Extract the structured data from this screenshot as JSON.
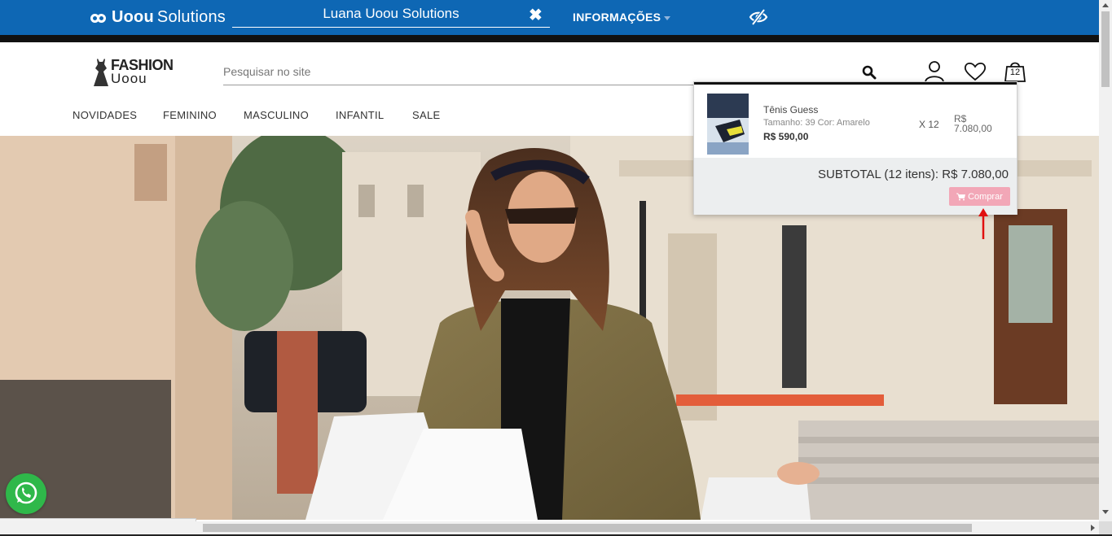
{
  "adminbar": {
    "brand_bold": "Uoou",
    "brand_light": "Solutions",
    "store_name": "Luana Uoou Solutions",
    "close_icon": "close-icon",
    "info_label": "INFORMAÇÕES",
    "eye_icon": "eye-slash-icon",
    "color": "#0e67b4"
  },
  "header": {
    "logo_line1": "FASHION",
    "logo_line2": "Uoou",
    "search_placeholder": "Pesquisar no site",
    "cart_count": "12"
  },
  "nav": {
    "items": [
      {
        "label": "NOVIDADES"
      },
      {
        "label": "FEMININO"
      },
      {
        "label": "MASCULINO"
      },
      {
        "label": "INFANTIL"
      },
      {
        "label": "SALE"
      }
    ]
  },
  "cart": {
    "item": {
      "name": "Tênis Guess",
      "attributes": "Tamanho: 39 Cor: Amarelo",
      "price": "R$ 590,00",
      "quantity": "X 12",
      "line_total": "R$ 7.080,00"
    },
    "subtotal": "SUBTOTAL (12 itens): R$ 7.080,00",
    "buy_label": "Comprar",
    "buy_color": "#f2a7b7"
  },
  "status": {
    "url": "https://atacado.uooucommerce.com.br/cart/"
  }
}
